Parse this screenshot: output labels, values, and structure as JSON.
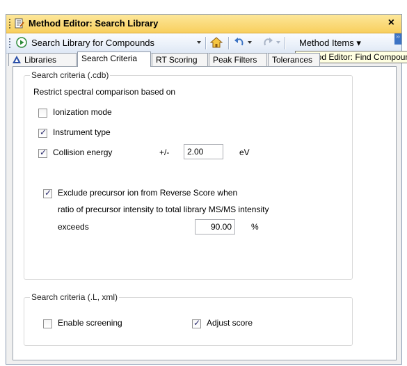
{
  "window": {
    "title": "Method Editor: Search Library",
    "close_glyph": "×"
  },
  "toolbar": {
    "run_label": "Search Library for Compounds",
    "method_items_label": "Method Items ▾",
    "overflow_glyph": "››"
  },
  "tooltip": {
    "text": "Method Editor: Find Compounds"
  },
  "tabs": [
    {
      "label": "Libraries"
    },
    {
      "label": "Search Criteria"
    },
    {
      "label": "RT Scoring"
    },
    {
      "label": "Peak Filters"
    },
    {
      "label": "Tolerances"
    }
  ],
  "group_cdb": {
    "label": "Search criteria (.cdb)",
    "restrict_text": "Restrict spectral comparison based on",
    "ionization_mode": {
      "label": "Ionization mode",
      "checked": false
    },
    "instrument_type": {
      "label": "Instrument type",
      "checked": true
    },
    "collision_energy": {
      "label": "Collision energy",
      "checked": true,
      "plusminus": "+/-",
      "value": "2.00",
      "unit": "eV"
    },
    "exclude_precursor": {
      "label": "Exclude precursor ion from Reverse Score when",
      "checked": true,
      "line2": "ratio of precursor intensity to total library MS/MS intensity",
      "line3": "exceeds",
      "value": "90.00",
      "unit": "%"
    }
  },
  "group_xml": {
    "label": "Search criteria (.L, xml)",
    "enable_screening": {
      "label": "Enable screening",
      "checked": false
    },
    "adjust_score": {
      "label": "Adjust score",
      "checked": true
    }
  },
  "colors": {
    "title_bar": "#f8cf5e",
    "accent_blue": "#3c73c4",
    "run_green": "#2e8b3a"
  }
}
